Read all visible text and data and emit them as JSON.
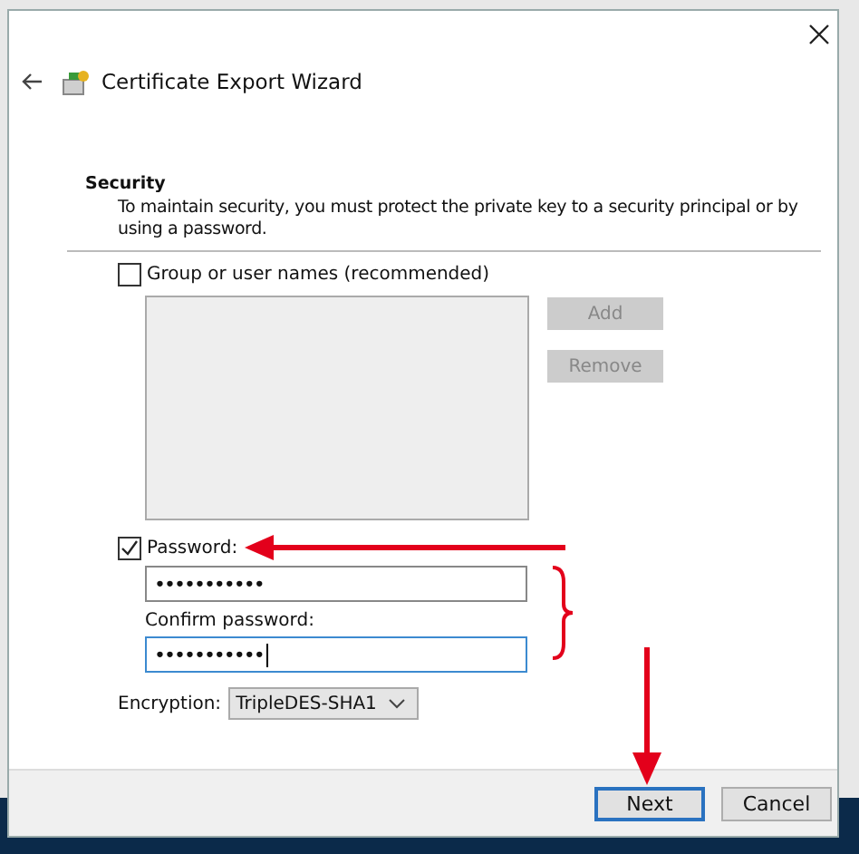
{
  "window": {
    "title": "Certificate Export Wizard"
  },
  "section": {
    "heading": "Security",
    "description": "To maintain security, you must protect the private key to a security principal or by using a password."
  },
  "group_option": {
    "label": "Group or user names (recommended)",
    "checked": false
  },
  "list_buttons": [
    {
      "label": "Add",
      "disabled": true
    },
    {
      "label": "Remove",
      "disabled": true
    }
  ],
  "password_option": {
    "label": "Password:",
    "checked": true
  },
  "password": {
    "value": "•••••••••••",
    "focused": false
  },
  "confirm": {
    "label": "Confirm password:",
    "value": "•••••••••••",
    "focused": true
  },
  "encryption": {
    "label": "Encryption:",
    "value": "TripleDES-SHA1"
  },
  "buttons": [
    {
      "label": "Next",
      "default": true
    },
    {
      "label": "Cancel",
      "default": false
    }
  ]
}
